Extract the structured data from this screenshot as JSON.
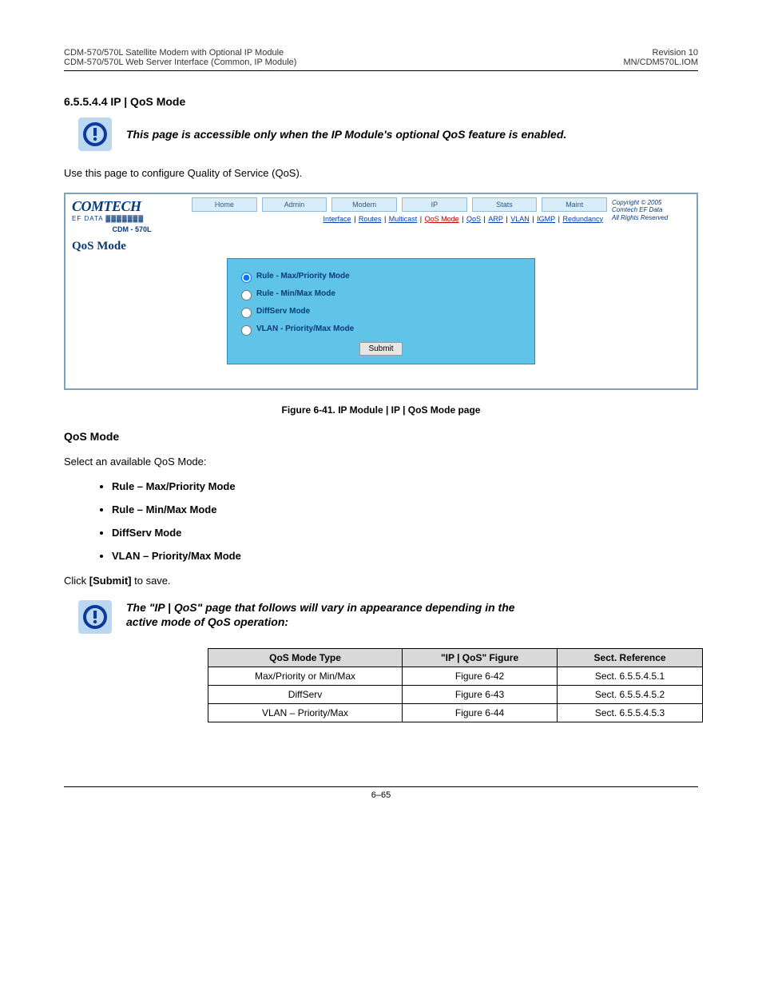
{
  "doc_header": {
    "left_line1": "CDM-570/570L Satellite Modem with Optional IP Module",
    "left_line2": "CDM-570/570L Web Server Interface (Common, IP Module)",
    "right_line1": "Revision 10",
    "right_line2": "MN/CDM570L.IOM"
  },
  "section_heading": "6.5.5.4.4   IP | QoS Mode",
  "important_primary": "This page is accessible only when the IP Module's optional QoS feature is enabled.",
  "intro_text": "Use this page to configure Quality of Service (QoS).",
  "ui": {
    "logo_main": "COMTECH",
    "logo_sub": "EF DATA ▓▓▓▓▓▓▓",
    "logo_model": "CDM - 570L",
    "tabs": [
      "Home",
      "Admin",
      "Modem",
      "IP",
      "Stats",
      "Maint"
    ],
    "links": [
      "Interface",
      "Routes",
      "Multicast",
      "QoS Mode",
      "QoS",
      "ARP",
      "VLAN",
      "IGMP",
      "Redundancy"
    ],
    "current_link": "QoS Mode",
    "copyright1": "Copyright © 2005",
    "copyright2": "Comtech EF Data",
    "copyright3": "All Rights Reserved",
    "page_title": "QoS Mode",
    "radios": [
      "Rule - Max/Priority Mode",
      "Rule - Min/Max Mode",
      "DiffServ Mode",
      "VLAN - Priority/Max Mode"
    ],
    "submit": "Submit"
  },
  "figure_caption": "Figure 6-41. IP Module | IP | QoS Mode page",
  "section_subheading": "QoS Mode",
  "body_para": "Select an available QoS Mode:",
  "modes": [
    "Rule – Max/Priority Mode",
    "Rule – Min/Max Mode",
    "DiffServ Mode",
    "VLAN – Priority/Max Mode"
  ],
  "save_note_prefix": "Click ",
  "save_note_bold": "[Submit]",
  "save_note_suffix": " to save.",
  "secondary_important_line1": "The \"IP | QoS\" page that follows will vary in appearance depending in the",
  "secondary_important_line2": "active mode of QoS operation:",
  "table": {
    "headers": [
      "QoS Mode Type",
      "\"IP | QoS\" Figure",
      "Sect. Reference"
    ],
    "rows": [
      [
        "Max/Priority or Min/Max",
        "Figure 6-42",
        "Sect. 6.5.5.4.5.1"
      ],
      [
        "DiffServ",
        "Figure 6-43",
        "Sect. 6.5.5.4.5.2"
      ],
      [
        "VLAN – Priority/Max",
        "Figure 6-44",
        "Sect. 6.5.5.4.5.3"
      ]
    ]
  },
  "page_number": "6–65"
}
